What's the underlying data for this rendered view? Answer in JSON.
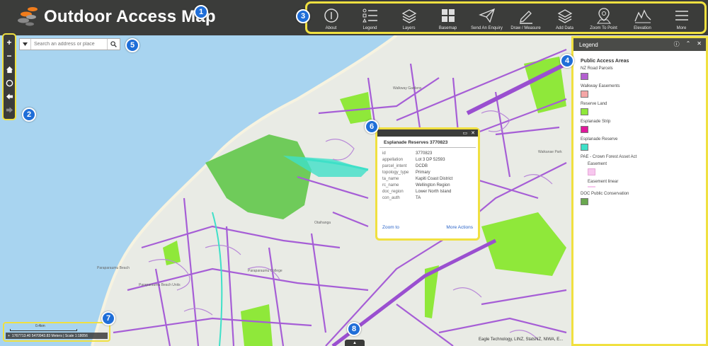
{
  "header": {
    "title": "Outdoor Access Map",
    "callout_title": "1",
    "callout_toolbar": "3"
  },
  "toolbar": [
    {
      "label": "About",
      "icon": "info-icon"
    },
    {
      "label": "Legend",
      "icon": "legend-icon"
    },
    {
      "label": "Layers",
      "icon": "layers-icon"
    },
    {
      "label": "Basemap",
      "icon": "basemap-icon"
    },
    {
      "label": "Send An Enquiry",
      "icon": "paper-plane-icon"
    },
    {
      "label": "Draw / Measure",
      "icon": "pencil-icon"
    },
    {
      "label": "Add Data",
      "icon": "add-data-icon"
    },
    {
      "label": "Zoom To Point",
      "icon": "map-pin-icon"
    },
    {
      "label": "Elevation",
      "icon": "elevation-icon"
    },
    {
      "label": "More",
      "icon": "menu-icon"
    }
  ],
  "navbar": {
    "callout": "2",
    "zoom_in": "+",
    "zoom_out": "−"
  },
  "search": {
    "placeholder": "Search an address or place",
    "callout": "5"
  },
  "legend": {
    "title": "Legend",
    "callout": "4",
    "layer_title": "Public Access Areas",
    "items": [
      {
        "label": "NZ Road Parcels",
        "color": "#b35fd0"
      },
      {
        "label": "Walkway Easements",
        "color": "#f4a6a6"
      },
      {
        "label": "Reserve Land",
        "color": "#8fe83a"
      },
      {
        "label": "Esplanade Strip",
        "color": "#e0189c"
      },
      {
        "label": "Esplanade Reserve",
        "color": "#3ee0c8"
      }
    ],
    "group_title": "PAE - Crown Forest Asset Act",
    "group_items": [
      {
        "label": "Easement",
        "color": "#f7c7ee"
      },
      {
        "label": "Easement linear",
        "color": "#f7c7ee"
      }
    ],
    "last_item": {
      "label": "DOC Public Conservation",
      "color": "#6aa84f"
    }
  },
  "popup": {
    "callout": "6",
    "title": "Esplanade Reserves 3770823",
    "fields": [
      {
        "key": "id",
        "value": "3770823"
      },
      {
        "key": "appellation",
        "value": "Lot 3 DP 52593"
      },
      {
        "key": "parcel_intent",
        "value": "DCDB"
      },
      {
        "key": "topology_type",
        "value": "Primary"
      },
      {
        "key": "ta_name",
        "value": "Kapiti Coast District"
      },
      {
        "key": "rc_name",
        "value": "Wellington Region"
      },
      {
        "key": "doc_region",
        "value": "Lower North Island"
      },
      {
        "key": "con_auth",
        "value": "TA"
      }
    ],
    "zoom_to": "Zoom to",
    "more_actions": "More Actions"
  },
  "scale": {
    "callout": "7",
    "label": "0.4km",
    "coords": "1767713.40 5470943.83 Meters | Scale 1:18056"
  },
  "bottom": {
    "callout": "8",
    "attribution": "Eagle Technology, LINZ, StatsNZ, NIWA, E..."
  },
  "map_labels": {
    "paraparaumu": "Paraparaumu Beach",
    "otaihanga": "Otaihanga",
    "walkway": "Walkway Gardens",
    "college": "Paraparaumu College",
    "beach_unit": "Paraparaumu Beach Units",
    "park": "Waikanae Park"
  }
}
